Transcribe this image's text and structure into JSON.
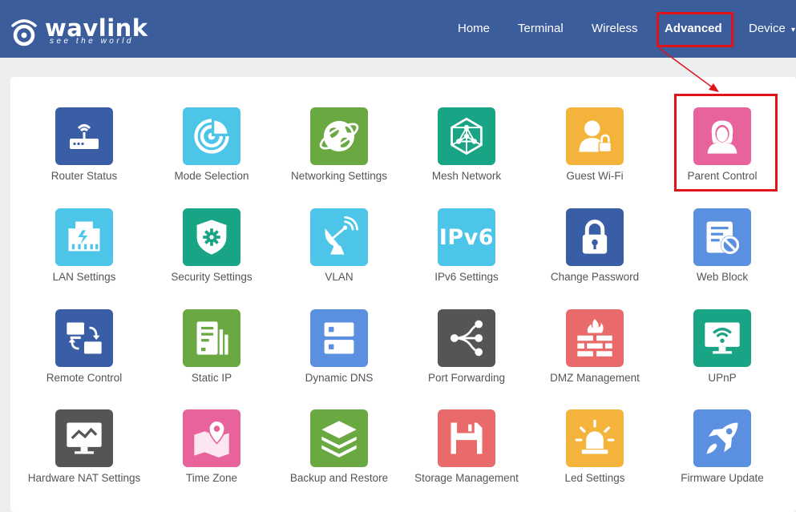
{
  "header": {
    "brand": "wavlink",
    "tagline": "see the world",
    "nav": [
      {
        "label": "Home"
      },
      {
        "label": "Terminal"
      },
      {
        "label": "Wireless"
      },
      {
        "label": "Advanced"
      },
      {
        "label": "Device"
      }
    ],
    "active": "Advanced"
  },
  "colors": {
    "header_bg": "#3b5d9c",
    "highlight": "#e0121a"
  },
  "tiles": [
    {
      "label": "Router Status",
      "icon": "router-icon",
      "color": "#3a5ea5"
    },
    {
      "label": "Mode Selection",
      "icon": "mode-target-icon",
      "color": "#4cc5e8"
    },
    {
      "label": "Networking Settings",
      "icon": "globe-icon",
      "color": "#6aa842"
    },
    {
      "label": "Mesh Network",
      "icon": "mesh-icon",
      "color": "#1aa486"
    },
    {
      "label": "Guest Wi-Fi",
      "icon": "guest-lock-icon",
      "color": "#f4b43c"
    },
    {
      "label": "Parent Control",
      "icon": "parent-icon",
      "color": "#e8629b"
    },
    {
      "label": "LAN Settings",
      "icon": "lan-port-icon",
      "color": "#4cc5e8"
    },
    {
      "label": "Security Settings",
      "icon": "shield-gear-icon",
      "color": "#1aa486"
    },
    {
      "label": "VLAN",
      "icon": "satellite-dish-icon",
      "color": "#4cc5e8"
    },
    {
      "label": "IPv6 Settings",
      "icon": "ipv6-icon",
      "color": "#4cc5e8",
      "text": "IPv6"
    },
    {
      "label": "Change Password",
      "icon": "padlock-icon",
      "color": "#3a5ea5"
    },
    {
      "label": "Web Block",
      "icon": "web-block-icon",
      "color": "#5b8fe0"
    },
    {
      "label": "Remote Control",
      "icon": "remote-computers-icon",
      "color": "#3a5ea5"
    },
    {
      "label": "Static IP",
      "icon": "static-ip-icon",
      "color": "#6aa842"
    },
    {
      "label": "Dynamic DNS",
      "icon": "server-icon",
      "color": "#5b8fe0"
    },
    {
      "label": "Port Forwarding",
      "icon": "share-icon",
      "color": "#555555"
    },
    {
      "label": "DMZ Management",
      "icon": "firewall-icon",
      "color": "#e86a6a"
    },
    {
      "label": "UPnP",
      "icon": "monitor-wifi-icon",
      "color": "#1aa486"
    },
    {
      "label": "Hardware NAT Settings",
      "icon": "monitor-chart-icon",
      "color": "#555555"
    },
    {
      "label": "Time Zone",
      "icon": "map-pin-icon",
      "color": "#e8629b"
    },
    {
      "label": "Backup and Restore",
      "icon": "layers-icon",
      "color": "#6aa842"
    },
    {
      "label": "Storage Management",
      "icon": "floppy-disk-icon",
      "color": "#e86a6a"
    },
    {
      "label": "Led Settings",
      "icon": "alarm-light-icon",
      "color": "#f4b43c"
    },
    {
      "label": "Firmware Update",
      "icon": "rocket-icon",
      "color": "#5b8fe0"
    }
  ]
}
